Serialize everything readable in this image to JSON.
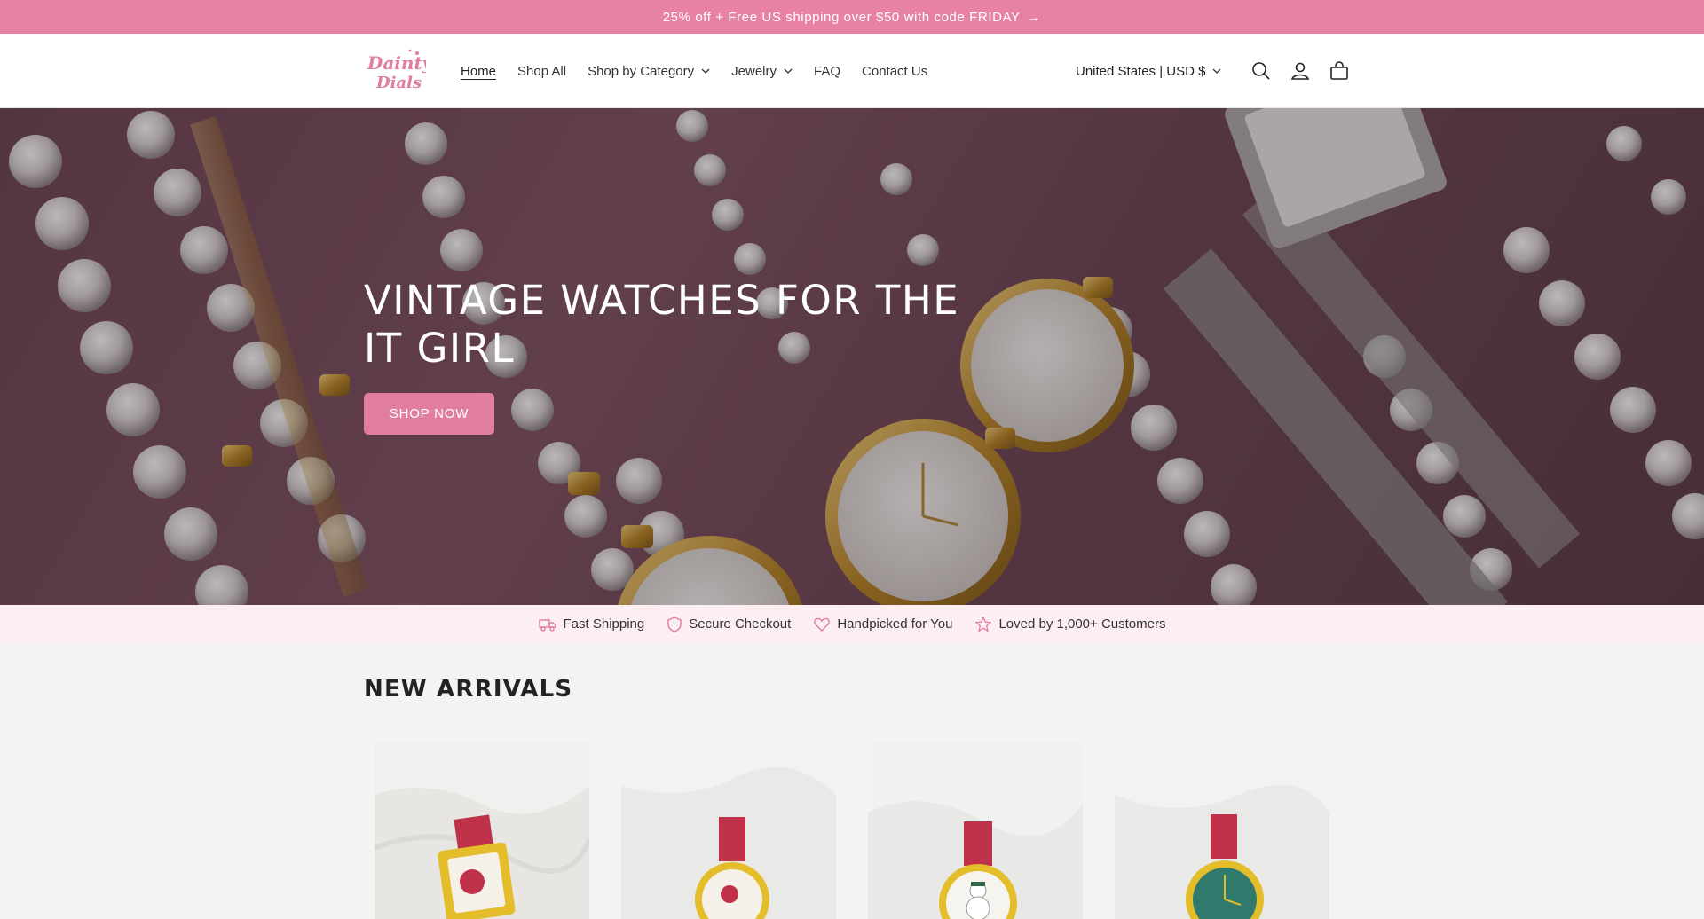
{
  "announcement": {
    "text": "25% off + Free US shipping over $50 with code FRIDAY",
    "arrow": "→"
  },
  "header": {
    "logo_text": "Dainty Dials",
    "nav": [
      {
        "label": "Home",
        "active": true,
        "dropdown": false
      },
      {
        "label": "Shop All",
        "active": false,
        "dropdown": false
      },
      {
        "label": "Shop by Category",
        "active": false,
        "dropdown": true
      },
      {
        "label": "Jewelry",
        "active": false,
        "dropdown": true
      },
      {
        "label": "FAQ",
        "active": false,
        "dropdown": false
      },
      {
        "label": "Contact Us",
        "active": false,
        "dropdown": false
      }
    ],
    "country_selector": "United States | USD $",
    "icons": [
      "search-icon",
      "account-icon",
      "cart-icon"
    ]
  },
  "hero": {
    "title": "VINTAGE WATCHES FOR THE IT GIRL",
    "cta": "SHOP NOW"
  },
  "features": [
    {
      "icon": "truck-icon",
      "label": "Fast Shipping"
    },
    {
      "icon": "shield-icon",
      "label": "Secure Checkout"
    },
    {
      "icon": "heart-icon",
      "label": "Handpicked for You"
    },
    {
      "icon": "star-icon",
      "label": "Loved by 1,000+ Customers"
    }
  ],
  "new_arrivals": {
    "title": "NEW ARRIVALS",
    "products": [
      {
        "image": "santa-watch-square"
      },
      {
        "image": "christmas-watch-round"
      },
      {
        "image": "snowman-watch"
      },
      {
        "image": "green-dial-watch"
      }
    ]
  },
  "colors": {
    "brand_pink": "#e782a5",
    "button_pink": "#e07da0",
    "feature_bg": "#fdeef2",
    "page_bg": "#f3f3f3"
  }
}
